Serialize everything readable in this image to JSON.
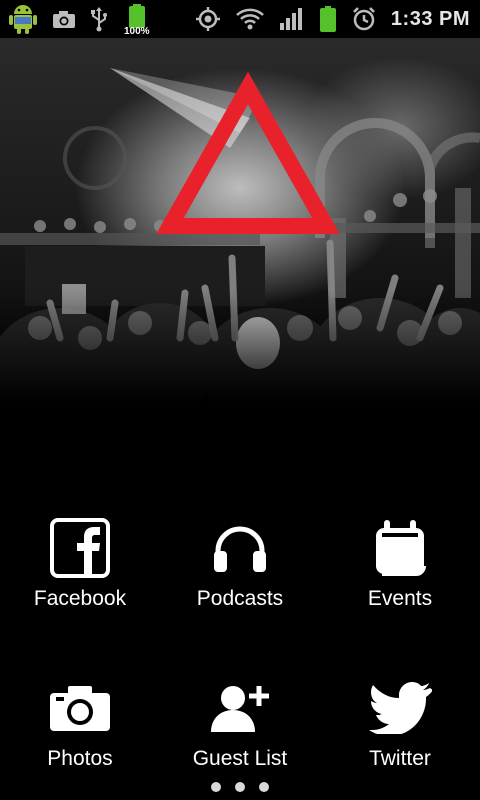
{
  "status_bar": {
    "time": "1:33 PM",
    "battery_percent": "100%",
    "icons": [
      "android-icon",
      "camera-icon",
      "usb-icon",
      "battery-icon",
      "gps-icon",
      "wifi-icon",
      "signal-icon",
      "battery-icon",
      "alarm-icon"
    ]
  },
  "hero": {
    "logo": "red-triangle-logo"
  },
  "menu": {
    "items": [
      {
        "label": "Facebook",
        "icon": "facebook-icon"
      },
      {
        "label": "Podcasts",
        "icon": "headphones-icon"
      },
      {
        "label": "Events",
        "icon": "calendar-icon"
      },
      {
        "label": "Photos",
        "icon": "camera-icon"
      },
      {
        "label": "Guest List",
        "icon": "add-user-icon"
      },
      {
        "label": "Twitter",
        "icon": "twitter-icon"
      }
    ]
  },
  "pager": {
    "pages": 3,
    "current": 1
  },
  "colors": {
    "accent": "#e8212b",
    "background": "#000000",
    "text": "#ffffff"
  }
}
